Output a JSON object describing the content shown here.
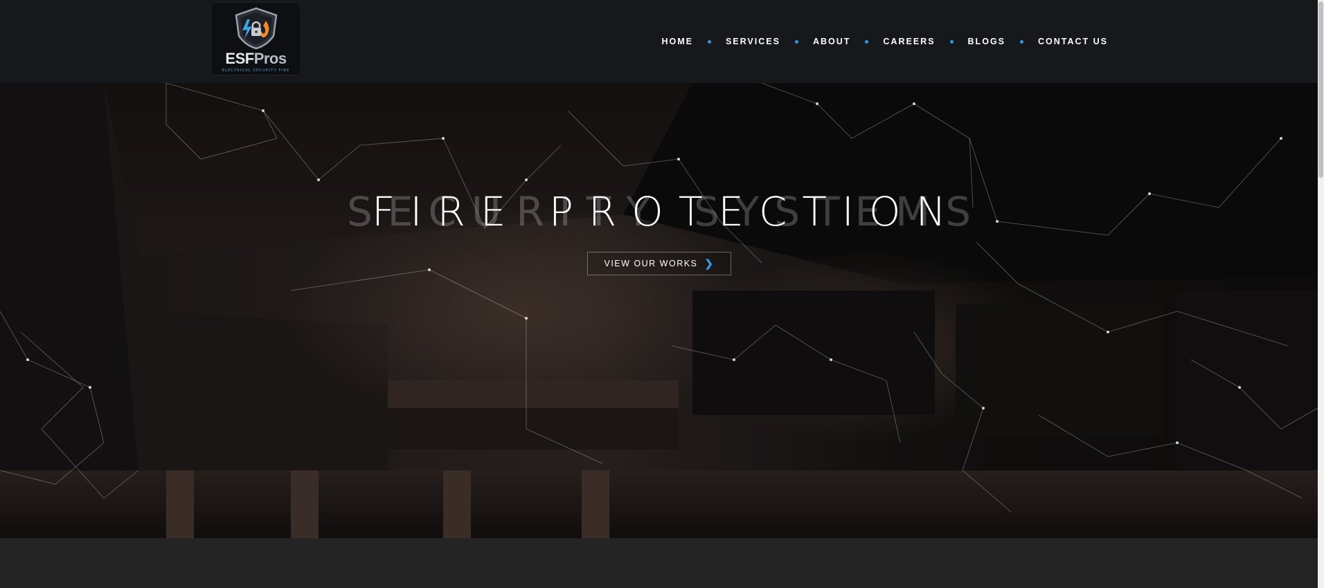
{
  "brand": {
    "name_part1": "ESF",
    "name_part2": "Pros",
    "tagline": "ELECTRICAL SECURITY FIRE"
  },
  "nav": {
    "items": [
      "HOME",
      "SERVICES",
      "ABOUT",
      "CAREERS",
      "BLOGS",
      "CONTACT US"
    ]
  },
  "hero": {
    "title": "FIRE PROTECTION",
    "ghost_title": "SECURITY SYSTEMS",
    "button_label": "VIEW OUR WORKS",
    "button_icon": "chevron-right-icon"
  },
  "colors": {
    "accent": "#2f9ae0",
    "header_bg": "#16181b",
    "page_bg": "#242425"
  }
}
